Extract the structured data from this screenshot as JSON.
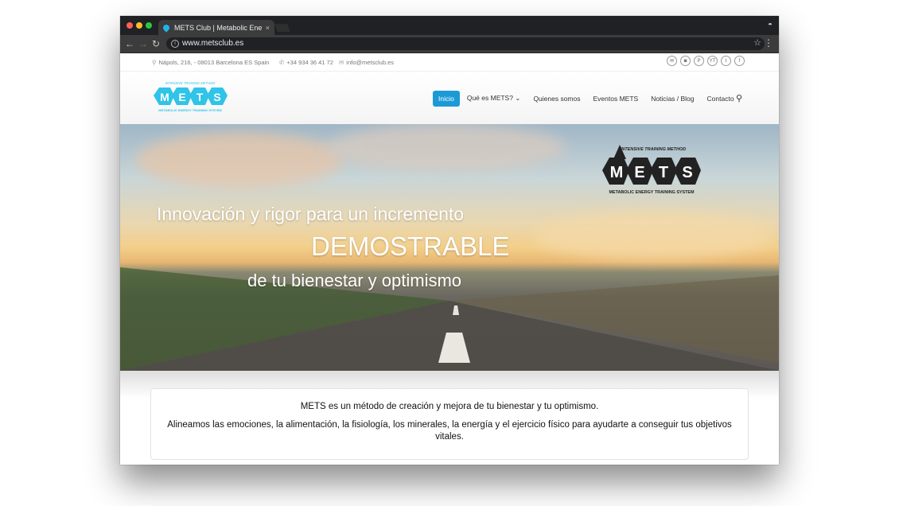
{
  "browser": {
    "tab_title": "METS Club | Metabolic Energy",
    "tab_close": "×",
    "url": "www.metsclub.es",
    "star": "☆",
    "menu": "⋮",
    "back": "←",
    "forward": "→",
    "reload": "↻"
  },
  "topbar": {
    "address": "Nápols, 216, - 08013 Barcelona ES Spain",
    "phone": "+34 934 36 41 72",
    "email": "info@metsclub.es",
    "socials": [
      "email-icon",
      "instagram-icon",
      "pinterest-icon",
      "youtube-icon",
      "twitter-icon",
      "facebook-icon"
    ],
    "social_glyphs": [
      "✉",
      "◙",
      "P",
      "YT",
      "t",
      "f"
    ]
  },
  "logo": {
    "top_text": "INTENSIVE TRAINING METHOD",
    "letters": [
      "M",
      "E",
      "T",
      "S"
    ],
    "bottom_text": "METABOLIC ENERGY TRAINING SYSTEM",
    "color": "#2fc4e8"
  },
  "nav": {
    "items": [
      {
        "label": "Inicio",
        "active": true
      },
      {
        "label": "Qué es METS? ⌄",
        "active": false
      },
      {
        "label": "Quienes somos",
        "active": false
      },
      {
        "label": "Eventos METS",
        "active": false
      },
      {
        "label": "Noticias / Blog",
        "active": false
      },
      {
        "label": "Contacto",
        "active": false
      }
    ],
    "active_color": "#1c9ad6"
  },
  "hero": {
    "line1": "Innovación y rigor para un incremento",
    "line2": "DEMOSTRABLE",
    "line3": "de tu bienestar y optimismo",
    "logo_top": "INTENSIVE TRAINING METHOD",
    "logo_letters": [
      "M",
      "E",
      "T",
      "S"
    ],
    "logo_bottom": "METABOLIC ENERGY TRAINING SYSTEM"
  },
  "intro": {
    "p1": "METS es un método de creación y mejora de tu bienestar y tu optimismo.",
    "p2": "Alineamos las emociones, la alimentación, la fisiología, los minerales, la energía y el ejercicio físico para ayudarte a conseguir tus objetivos vitales."
  }
}
